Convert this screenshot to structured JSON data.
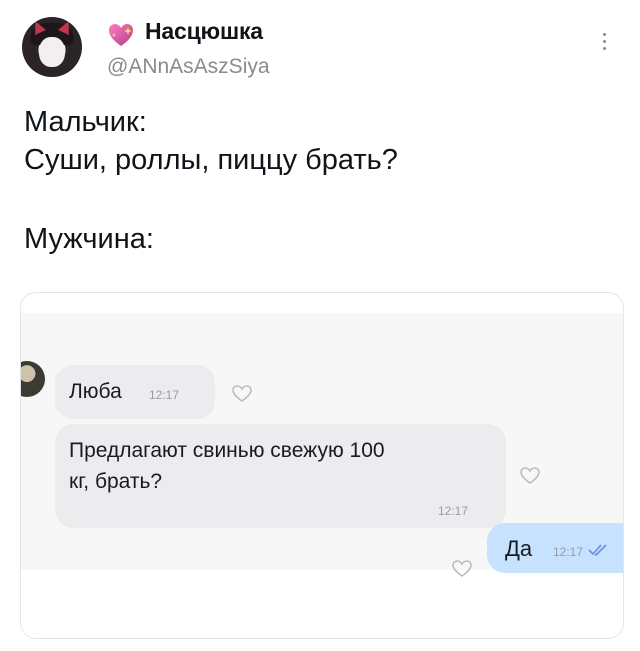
{
  "tweet": {
    "author": {
      "display_name": "Насцюшка",
      "handle": "@ANnAsAszSiya",
      "name_emoji": "sparkling-heart-icon"
    },
    "lines": [
      "Мальчик:",
      "Суши, роллы, пиццу брать?",
      "Мужчина:"
    ]
  },
  "chat": {
    "messages": [
      {
        "direction": "incoming",
        "text": "Люба",
        "time": "12:17"
      },
      {
        "direction": "incoming",
        "text_lines": [
          "Предлагают свинью свежую 100",
          "кг, брать?"
        ],
        "time": "12:17"
      },
      {
        "direction": "outgoing",
        "text": "Да",
        "time": "12:17",
        "status": "read-double-check"
      }
    ]
  },
  "colors": {
    "outgoing_bubble": "#c6e2ff",
    "incoming_bubble": "#ececee",
    "read_check": "#6a8fd8",
    "handle_gray": "#8a8a8f"
  }
}
